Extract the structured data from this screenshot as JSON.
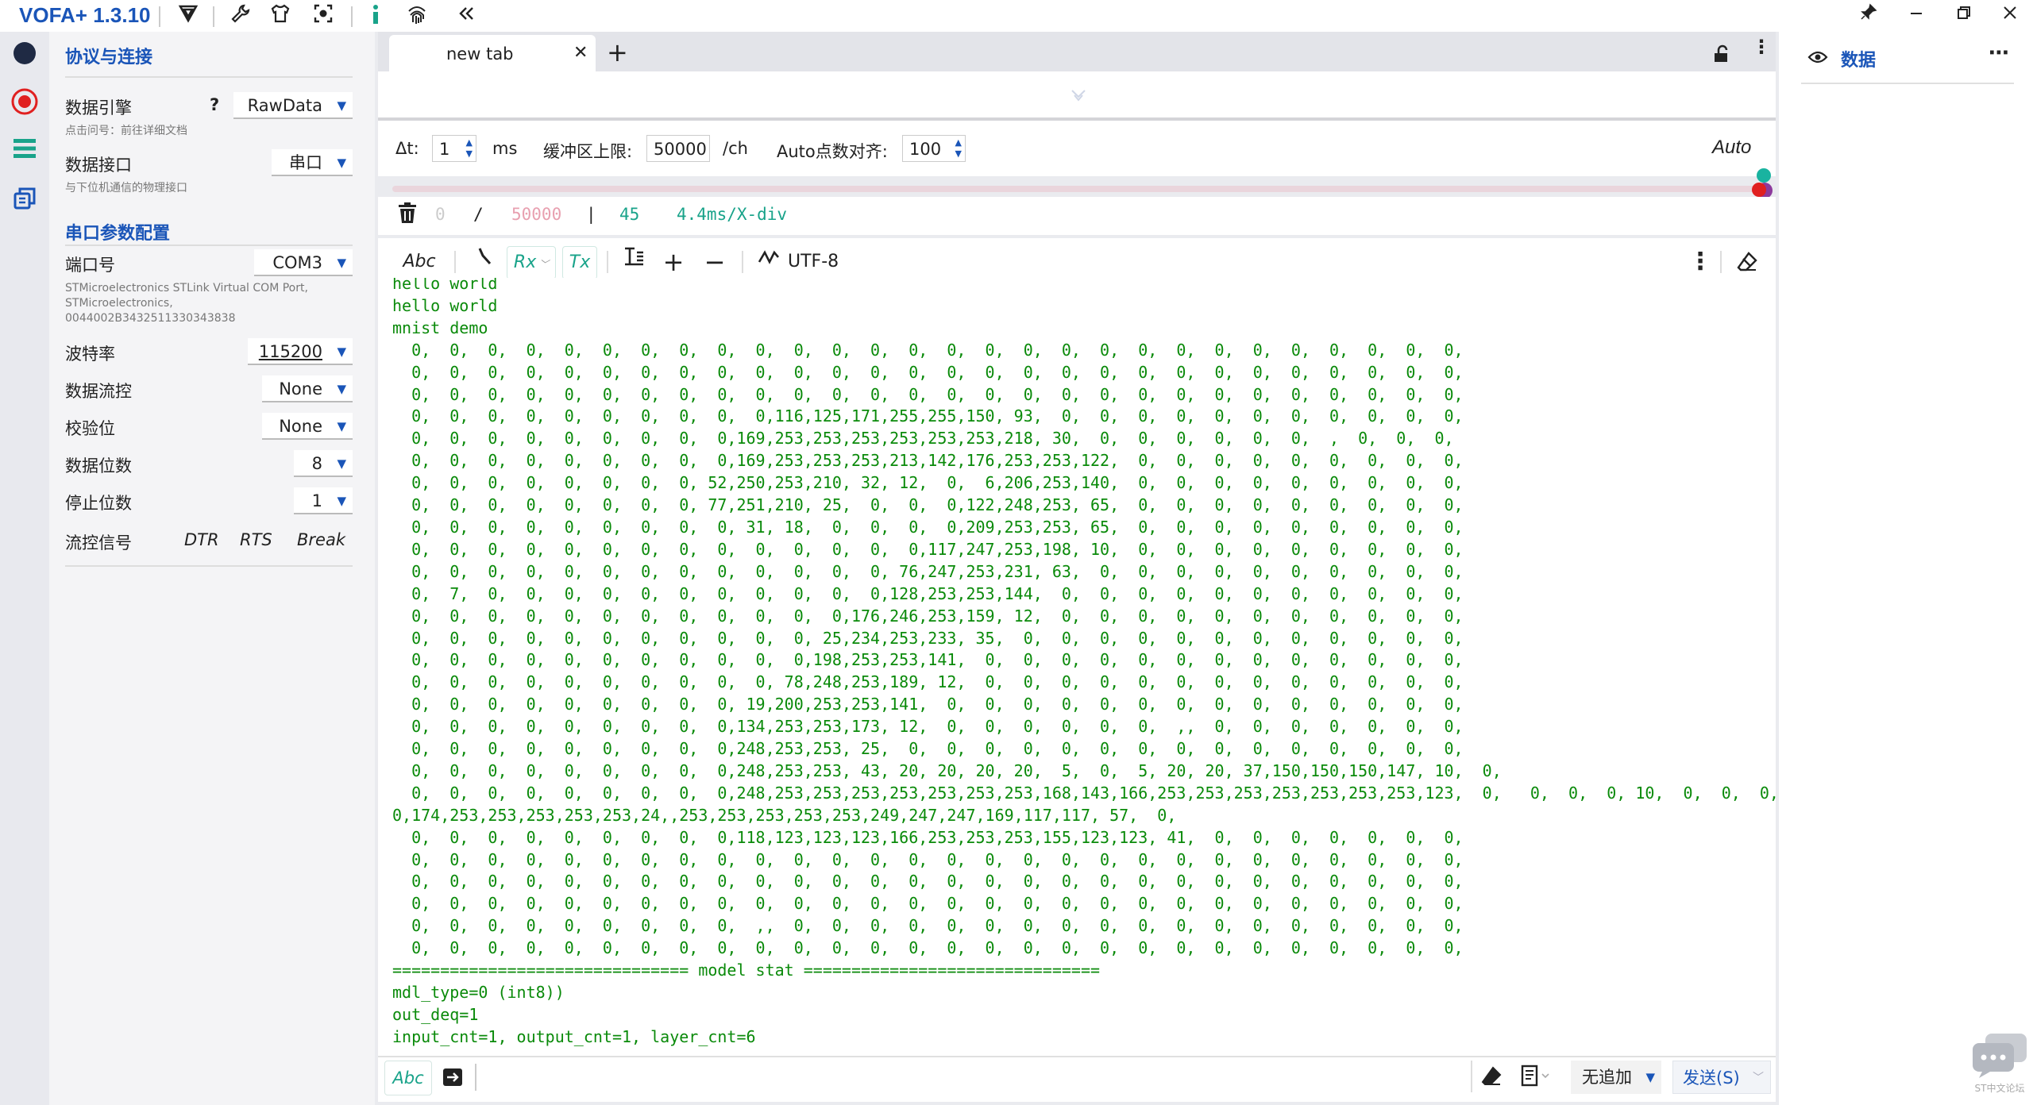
{
  "app": {
    "title": "VOFA+ 1.3.10"
  },
  "sidebar": {
    "section_title": "协议与连接",
    "engine": {
      "label": "数据引擎",
      "help": "?",
      "value": "RawData",
      "hint": "点击问号：前往详细文档"
    },
    "interface": {
      "label": "数据接口",
      "value": "串口",
      "hint": "与下位机通信的物理接口"
    },
    "serial_title": "串口参数配置",
    "port": {
      "label": "端口号",
      "value": "COM3",
      "desc1": "STMicroelectronics STLink Virtual COM Port,",
      "desc2": "STMicroelectronics,",
      "desc3": "0044002B3432511330343838"
    },
    "baud": {
      "label": "波特率",
      "value": "115200"
    },
    "flow": {
      "label": "数据流控",
      "value": "None"
    },
    "parity": {
      "label": "校验位",
      "value": "None"
    },
    "databits": {
      "label": "数据位数",
      "value": "8"
    },
    "stopbits": {
      "label": "停止位数",
      "value": "1"
    },
    "signals": {
      "label": "流控信号",
      "dtr": "DTR",
      "rts": "RTS",
      "brk": "Break"
    }
  },
  "tabs": [
    {
      "label": "new tab"
    }
  ],
  "controls": {
    "dt_label": "Δt:",
    "dt_value": "1",
    "dt_unit": "ms",
    "buffer_label": "缓冲区上限:",
    "buffer_value": "50000",
    "buffer_unit": "/ch",
    "align_label": "Auto点数对齐:",
    "align_value": "100",
    "auto": "Auto"
  },
  "info": {
    "current": "0",
    "sep1": "/",
    "max": "50000",
    "sep2": "|",
    "points": "45",
    "xdiv": "4.4ms/X-div"
  },
  "toolbar": {
    "abc": "Abc",
    "rx": "Rx",
    "tx": "Tx",
    "encoding": "UTF-8"
  },
  "console": {
    "text": "hello world\nhello world\nmnist demo\n  0,  0,  0,  0,  0,  0,  0,  0,  0,  0,  0,  0,  0,  0,  0,  0,  0,  0,  0,  0,  0,  0,  0,  0,  0,  0,  0,  0,\n  0,  0,  0,  0,  0,  0,  0,  0,  0,  0,  0,  0,  0,  0,  0,  0,  0,  0,  0,  0,  0,  0,  0,  0,  0,  0,  0,  0,\n  0,  0,  0,  0,  0,  0,  0,  0,  0,  0,  0,  0,  0,  0,  0,  0,  0,  0,  0,  0,  0,  0,  0,  0,  0,  0,  0,  0,\n  0,  0,  0,  0,  0,  0,  0,  0,  0,  0,116,125,171,255,255,150, 93,  0,  0,  0,  0,  0,  0,  0,  0,  0,  0,  0,\n  0,  0,  0,  0,  0,  0,  0,  0,  0,169,253,253,253,253,253,253,218, 30,  0,  0,  0,  0,  0,  0,  ,  0,  0,  0,\n  0,  0,  0,  0,  0,  0,  0,  0,  0,169,253,253,253,213,142,176,253,253,122,  0,  0,  0,  0,  0,  0,  0,  0,  0,\n  0,  0,  0,  0,  0,  0,  0,  0, 52,250,253,210, 32, 12,  0,  6,206,253,140,  0,  0,  0,  0,  0,  0,  0,  0,  0,\n  0,  0,  0,  0,  0,  0,  0,  0, 77,251,210, 25,  0,  0,  0,122,248,253, 65,  0,  0,  0,  0,  0,  0,  0,  0,  0,\n  0,  0,  0,  0,  0,  0,  0,  0,  0, 31, 18,  0,  0,  0,  0,209,253,253, 65,  0,  0,  0,  0,  0,  0,  0,  0,  0,\n  0,  0,  0,  0,  0,  0,  0,  0,  0,  0,  0,  0,  0,  0,117,247,253,198, 10,  0,  0,  0,  0,  0,  0,  0,  0,  0,\n  0,  0,  0,  0,  0,  0,  0,  0,  0,  0,  0,  0,  0, 76,247,253,231, 63,  0,  0,  0,  0,  0,  0,  0,  0,  0,  0,\n  0,  7,  0,  0,  0,  0,  0,  0,  0,  0,  0,  0,  0,128,253,253,144,  0,  0,  0,  0,  0,  0,  0,  0,  0,  0,  0,\n  0,  0,  0,  0,  0,  0,  0,  0,  0,  0,  0,  0,176,246,253,159, 12,  0,  0,  0,  0,  0,  0,  0,  0,  0,  0,  0,\n  0,  0,  0,  0,  0,  0,  0,  0,  0,  0,  0, 25,234,253,233, 35,  0,  0,  0,  0,  0,  0,  0,  0,  0,  0,  0,  0,\n  0,  0,  0,  0,  0,  0,  0,  0,  0,  0,  0,198,253,253,141,  0,  0,  0,  0,  0,  0,  0,  0,  0,  0,  0,  0,  0,\n  0,  0,  0,  0,  0,  0,  0,  0,  0,  0, 78,248,253,189, 12,  0,  0,  0,  0,  0,  0,  0,  0,  0,  0,  0,  0,  0,\n  0,  0,  0,  0,  0,  0,  0,  0,  0, 19,200,253,253,141,  0,  0,  0,  0,  0,  0,  0,  0,  0,  0,  0,  0,  0,  0,\n  0,  0,  0,  0,  0,  0,  0,  0,  0,134,253,253,173, 12,  0,  0,  0,  0,  0,  0,  ,,  0,  0,  0,  0,  0,  0,  0,\n  0,  0,  0,  0,  0,  0,  0,  0,  0,248,253,253, 25,  0,  0,  0,  0,  0,  0,  0,  0,  0,  0,  0,  0,  0,  0,  0,\n  0,  0,  0,  0,  0,  0,  0,  0,  0,248,253,253, 43, 20, 20, 20, 20,  5,  0,  5, 20, 20, 37,150,150,150,147, 10,  0,\n  0,  0,  0,  0,  0,  0,  0,  0,  0,248,253,253,253,253,253,253,253,168,143,166,253,253,253,253,253,253,253,123,  0,   0,  0,  0, 10,  0,  0,  0,\n0,174,253,253,253,253,253,24,,253,253,253,253,253,249,247,247,169,117,117, 57,  0,\n  0,  0,  0,  0,  0,  0,  0,  0,  0,118,123,123,123,166,253,253,253,155,123,123, 41,  0,  0,  0,  0,  0,  0,  0,\n  0,  0,  0,  0,  0,  0,  0,  0,  0,  0,  0,  0,  0,  0,  0,  0,  0,  0,  0,  0,  0,  0,  0,  0,  0,  0,  0,  0,\n  0,  0,  0,  0,  0,  0,  0,  0,  0,  0,  0,  0,  0,  0,  0,  0,  0,  0,  0,  0,  0,  0,  0,  0,  0,  0,  0,  0,\n  0,  0,  0,  0,  0,  0,  0,  0,  0,  0,  0,  0,  0,  0,  0,  0,  0,  0,  0,  0,  0,  0,  0,  0,  0,  0,  0,  0,\n  0,  0,  0,  0,  0,  0,  0,  0,  0,  ,,  0,  0,  0,  0,  0,  0,  0,  0,  0,  0,  0,  0,  0,  0,  0,  0,  0,  0,\n  0,  0,  0,  0,  0,  0,  0,  0,  0,  0,  0,  0,  0,  0,  0,  0,  0,  0,  0,  0,  0,  0,  0,  0,  0,  0,  0,  0,\n=============================== model stat ===============================\nmdl_type=0 (int8))\nout_deq=1\ninput_cnt=1, output_cnt=1, layer_cnt=6"
  },
  "send": {
    "abc": "Abc",
    "append": "无追加",
    "send_label": "发送(S)"
  },
  "right_panel": {
    "title": "数据"
  },
  "watermark": {
    "text": "ST中文论坛"
  },
  "colors": {
    "accent": "#1a55b8",
    "console_text": "#0a8a0a",
    "record": "#e02020",
    "teal": "#19a38a"
  }
}
